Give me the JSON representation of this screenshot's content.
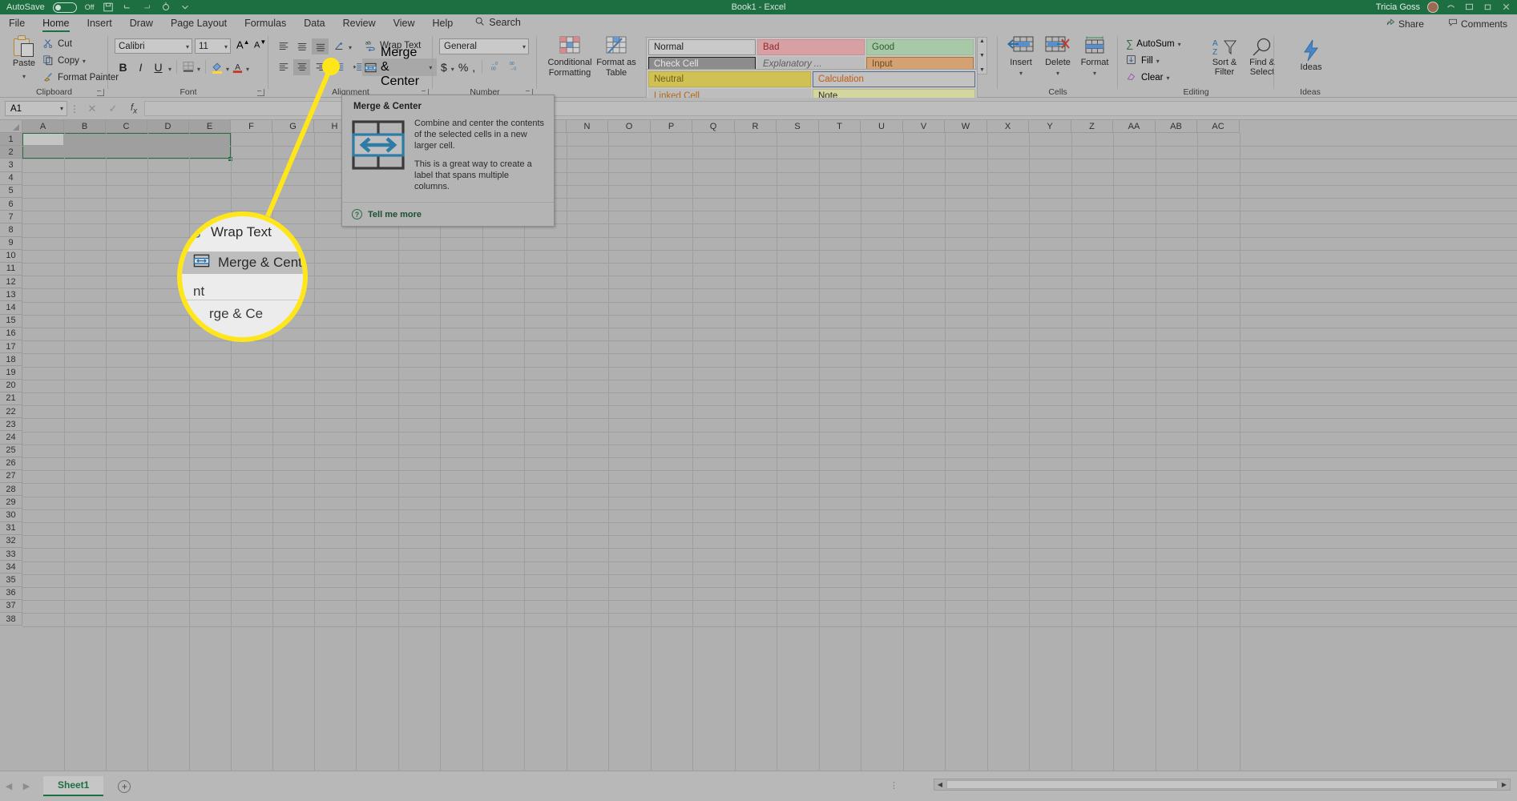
{
  "titlebar": {
    "autosave_label": "AutoSave",
    "autosave_state": "Off",
    "doc_title": "Book1 - Excel",
    "user_name": "Tricia Goss",
    "qat_icons": [
      "save-icon",
      "undo-icon",
      "redo-icon",
      "touch-mode-icon",
      "customize-qat-icon"
    ],
    "right_icons": [
      "ribbon-display-options-icon",
      "minimize-icon",
      "restore-icon",
      "close-icon"
    ]
  },
  "tabs": [
    {
      "label": "File",
      "active": false
    },
    {
      "label": "Home",
      "active": true
    },
    {
      "label": "Insert",
      "active": false
    },
    {
      "label": "Draw",
      "active": false
    },
    {
      "label": "Page Layout",
      "active": false
    },
    {
      "label": "Formulas",
      "active": false
    },
    {
      "label": "Data",
      "active": false
    },
    {
      "label": "Review",
      "active": false
    },
    {
      "label": "View",
      "active": false
    },
    {
      "label": "Help",
      "active": false
    }
  ],
  "search": {
    "label": "Search",
    "icon": "search-icon"
  },
  "tabstrip_right": [
    {
      "label": "Share",
      "icon": "share-icon"
    },
    {
      "label": "Comments",
      "icon": "comment-icon"
    }
  ],
  "ribbon": {
    "clipboard": {
      "group_label": "Clipboard",
      "paste_label": "Paste",
      "cut_label": "Cut",
      "copy_label": "Copy",
      "format_painter_label": "Format Painter"
    },
    "font": {
      "group_label": "Font",
      "font_name": "Calibri",
      "font_size": "11",
      "grow_font_label": "A",
      "shrink_font_label": "A",
      "bold_label": "B",
      "italic_label": "I",
      "underline_label": "U"
    },
    "alignment": {
      "group_label": "Alignment",
      "wrap_text_label": "Wrap Text",
      "merge_center_label": "Merge & Center"
    },
    "number": {
      "group_label": "Number",
      "format_value": "General",
      "currency_label": "$",
      "percent_label": "%",
      "comma_label": ",",
      "increase_decimal_label": "←.0",
      "decrease_decimal_label": ".00"
    },
    "styles": {
      "group_label": "Styles",
      "conditional_formatting_label": "Conditional Formatting",
      "format_as_table_label": "Format as Table",
      "cell_styles": [
        {
          "name": "Normal",
          "bg": "#c9c9c9",
          "fg": "#1f1f1f",
          "border": "#8f8f8f",
          "italic": false
        },
        {
          "name": "Bad",
          "bg": "#d9a0a4",
          "fg": "#8a2a2f",
          "border": "#c98f94",
          "italic": false
        },
        {
          "name": "Good",
          "bg": "#a8c9a8",
          "fg": "#2c5c2c",
          "border": "#97bb97",
          "italic": false
        },
        {
          "name": "Check Cell",
          "bg": "#8c8c8c",
          "fg": "#e6e6e6",
          "border": "#1f1f1f",
          "italic": false
        },
        {
          "name": "Explanatory ...",
          "bg": "#bdbdbd",
          "fg": "#5c5c5c",
          "border": "transparent",
          "italic": true
        },
        {
          "name": "Input",
          "bg": "#d4a173",
          "fg": "#6b4a22",
          "border": "#a8743c",
          "italic": false
        },
        {
          "name": "Neutral",
          "bg": "#cfc154",
          "fg": "#6e5f16",
          "border": "#bdae47",
          "italic": false
        },
        {
          "name": "Calculation",
          "bg": "#c2c2c2",
          "fg": "#c05a14",
          "border": "#5b6b8c",
          "italic": false
        },
        {
          "name": "Linked Cell",
          "bg": "#bdbdbd",
          "fg": "#b06a1a",
          "border": "transparent",
          "italic": false
        },
        {
          "name": "Note",
          "bg": "#d4d6a0",
          "fg": "#2f2f2f",
          "border": "#b9bb80",
          "italic": false
        }
      ]
    },
    "cells": {
      "group_label": "Cells",
      "insert_label": "Insert",
      "delete_label": "Delete",
      "format_label": "Format"
    },
    "editing": {
      "group_label": "Editing",
      "autosum_label": "AutoSum",
      "fill_label": "Fill",
      "clear_label": "Clear",
      "sort_filter_label": "Sort & Filter",
      "find_select_label": "Find & Select"
    },
    "ideas": {
      "group_label": "Ideas",
      "ideas_label": "Ideas"
    }
  },
  "formula_bar": {
    "name_box_value": "A1",
    "formula_value": "",
    "cancel_icon": "cancel-icon",
    "enter_icon": "checkmark-icon",
    "function_icon": "fx-icon"
  },
  "grid": {
    "columns": [
      "A",
      "B",
      "C",
      "D",
      "E",
      "F",
      "G",
      "H",
      "I",
      "J",
      "K",
      "L",
      "M",
      "N",
      "O",
      "P",
      "Q",
      "R",
      "S",
      "T",
      "U",
      "V",
      "W",
      "X",
      "Y",
      "Z",
      "AA",
      "AB",
      "AC"
    ],
    "rows": [
      1,
      2,
      3,
      4,
      5,
      6,
      7,
      8,
      9,
      10,
      11,
      12,
      13,
      14,
      15,
      16,
      17,
      18,
      19,
      20,
      21,
      22,
      23,
      24,
      25,
      26,
      27,
      28,
      29,
      30,
      31,
      32,
      33,
      34,
      35,
      36,
      37,
      38
    ],
    "selection_range": "A1:E2",
    "active_cell": "A1"
  },
  "tooltip": {
    "title": "Merge & Center",
    "paragraph1": "Combine and center the contents of the selected cells in a new larger cell.",
    "paragraph2": "This is a great way to create a label that spans multiple columns.",
    "link_label": "Tell me more",
    "help_icon": "help-circle-icon"
  },
  "callout": {
    "wrap_text_label": "Wrap Text",
    "merge_center_label": "Merge & Center",
    "partial_top_label": "nt",
    "partial_bottom_label": "rge & Ce",
    "highlight_color": "#ffe61a"
  },
  "sheet_tabs": {
    "sheets": [
      {
        "label": "Sheet1",
        "active": true
      }
    ],
    "add_sheet_label": "+",
    "prev_icon": "prev-sheet-icon",
    "next_icon": "next-sheet-icon"
  },
  "colors": {
    "excel_green": "#1d6f42",
    "ribbon_bg": "#b8b8b8",
    "grid_bg": "#b0b0b0",
    "selection_border": "#2b6a43"
  }
}
